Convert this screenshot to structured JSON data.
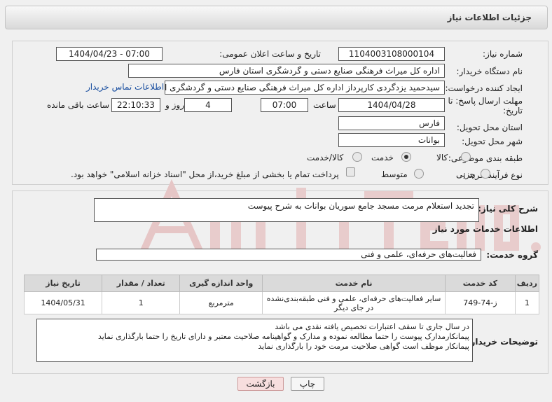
{
  "header": {
    "title": "جزئیات اطلاعات نیاز"
  },
  "form": {
    "need_number_label": "شماره نیاز:",
    "need_number": "1104003108000104",
    "announce_label": "تاریخ و ساعت اعلان عمومی:",
    "announce_value": "1404/04/23 - 07:00",
    "buyer_label": "نام دستگاه خریدار:",
    "buyer_value": "اداره کل میراث فرهنگی  صنایع دستی و گردشگری استان فارس",
    "creator_label": "ایجاد کننده درخواست:",
    "creator_value": "سیدحمید یزدگردی کارپرداز اداره کل میراث فرهنگی  صنایع دستی و گردشگری ا",
    "contact_link": "اطلاعات تماس خریدار",
    "deadline_label_1": "مهلت ارسال پاسخ: تا",
    "deadline_label_2": "تاریخ:",
    "deadline_date": "1404/04/28",
    "hour_label": "ساعت",
    "deadline_time": "07:00",
    "days_value": "4",
    "days_label": "روز و",
    "remaining_time": "22:10:33",
    "remaining_label": "ساعت باقی مانده",
    "province_label": "استان محل تحویل:",
    "province_value": "فارس",
    "city_label": "شهر محل تحویل:",
    "city_value": "بوانات",
    "category_label": "طبقه بندی موضوعی:",
    "category_options": [
      "کالا",
      "خدمت",
      "کالا/خدمت"
    ],
    "category_selected": "خدمت",
    "process_label": "نوع فرآیند خرید :",
    "process_options": [
      "جزیی",
      "متوسط"
    ],
    "payment_note": "پرداخت تمام یا بخشی از مبلغ خرید،از محل \"اسناد خزانه اسلامی\" خواهد بود."
  },
  "summary": {
    "label": "شرح کلی نیاز:",
    "value": "تجدید استعلام مرمت مسجد جامع سوریان بوانات به شرح پیوست"
  },
  "services": {
    "section_title": "اطلاعات خدمات مورد نیاز",
    "group_label": "گروه خدمت:",
    "group_value": "فعالیت‌های حرفه‌ای، علمی و فنی",
    "columns": [
      "ردیف",
      "کد خدمت",
      "نام خدمت",
      "واحد اندازه گیری",
      "تعداد / مقدار",
      "تاریخ نیاز"
    ],
    "rows": [
      {
        "row": "1",
        "code": "ز-74-749",
        "name": "سایر فعالیت‌های حرفه‌ای، علمی و فنی طبقه‌بندی‌نشده در جای دیگر",
        "unit": "مترمربع",
        "qty": "1",
        "date": "1404/05/31"
      }
    ]
  },
  "buyer_notes": {
    "label": "توضیحات خریدار:",
    "lines": [
      "در سال جاری تا سقف اعتبارات تخصیص یافته نقدی می باشد",
      "پیمانکارمدارک پیوست را حتما مطالعه نموده و مدارک و گواهینامه صلاحیت معتبر و دارای تاریخ را حتما بارگذاری نماید",
      "پیمانکار موظف است گواهی صلاحیت مرمت خود را بارگذاری نماید"
    ]
  },
  "buttons": {
    "print": "چاپ",
    "back": "بازگشت"
  },
  "colors": {
    "link": "#1a4fa0",
    "back_button_bg": "#f7dede",
    "watermark": "#e4c9c9"
  }
}
